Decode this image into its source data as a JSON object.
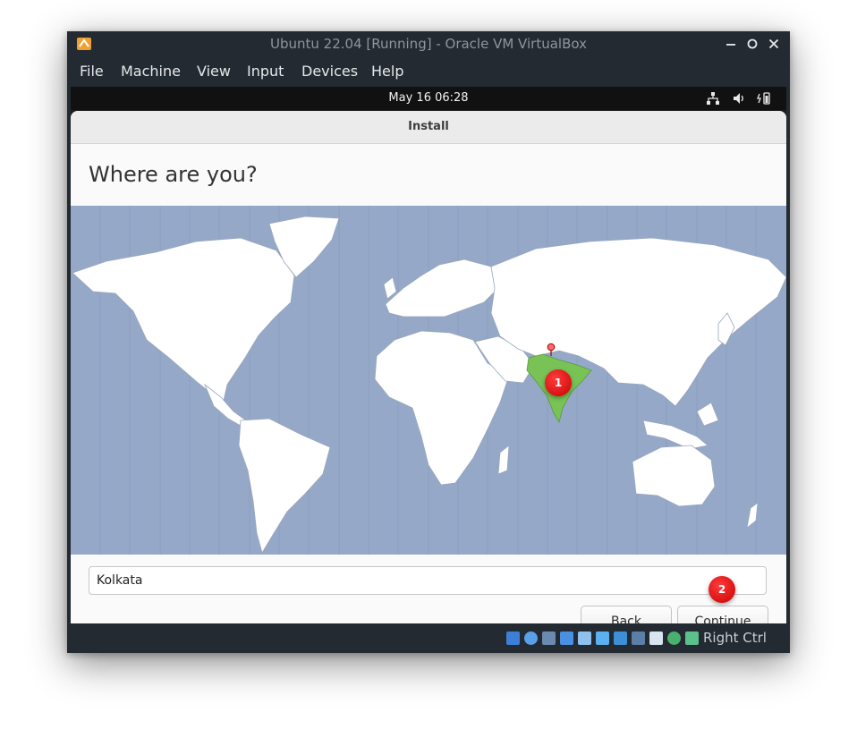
{
  "window": {
    "title": "Ubuntu 22.04 [Running] - Oracle VM VirtualBox",
    "minimize_icon": "minimize-icon",
    "maximize_icon": "maximize-icon",
    "close_icon": "close-icon"
  },
  "menubar": {
    "items": [
      {
        "label": "File"
      },
      {
        "label": "Machine"
      },
      {
        "label": "View"
      },
      {
        "label": "Input"
      },
      {
        "label": "Devices"
      },
      {
        "label": "Help"
      }
    ]
  },
  "guest_topbar": {
    "clock": "May 16  06:28",
    "icons": [
      "network-icon",
      "volume-icon",
      "power-icon"
    ]
  },
  "installer": {
    "header_title": "Install",
    "heading": "Where are you?",
    "location_value": "Kolkata",
    "back_label": "Back",
    "continue_label": "Continue",
    "selected_region": "India",
    "colors": {
      "ocean": "#95a8c8",
      "land": "#ffffff",
      "selected_land": "#78c256"
    }
  },
  "annotations": [
    {
      "label": "1"
    },
    {
      "label": "2"
    }
  ],
  "statusbar": {
    "host_key": "Right Ctrl",
    "icons": [
      "hard-disk-icon",
      "optical-disk-icon",
      "audio-icon",
      "network-adapter-icon",
      "usb-icon",
      "shared-folder-icon",
      "display-icon",
      "recording-icon",
      "video-capture-icon",
      "cpu-icon",
      "mouse-integration-icon",
      "keyboard-capture-icon"
    ]
  }
}
